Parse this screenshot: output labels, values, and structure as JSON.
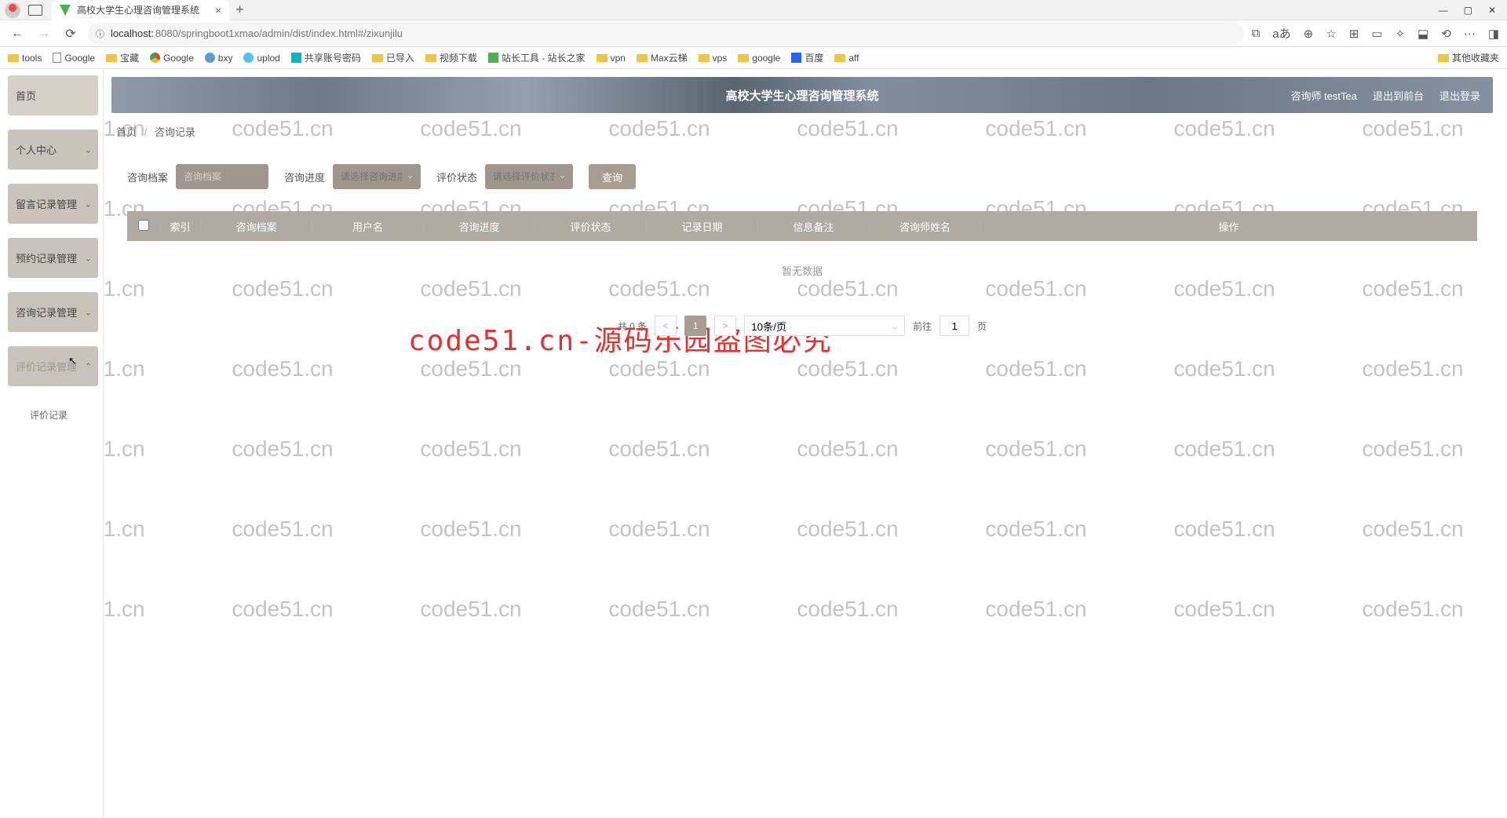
{
  "browser": {
    "tab_title": "高校大学生心理咨询管理系统",
    "url_host": "localhost:",
    "url_path": "8080/springboot1xmao/admin/dist/index.html#/zixunjilu",
    "addr_info_icon": "ⓘ"
  },
  "bookmarks": {
    "items": [
      "tools",
      "Google",
      "宝藏",
      "Google",
      "bxy",
      "uplod",
      "共享账号密码",
      "已导入",
      "视频下载",
      "站长工具 - 站长之家",
      "vpn",
      "Max云梯",
      "vps",
      "google",
      "百度",
      "aff"
    ],
    "other": "其他收藏夹"
  },
  "sidebar": {
    "home": "首页",
    "items": [
      "个人中心",
      "留言记录管理",
      "预约记录管理",
      "咨询记录管理",
      "评价记录管理"
    ],
    "sub_item": "评价记录"
  },
  "header": {
    "title": "高校大学生心理咨询管理系统",
    "user_role": "咨询师 testTea",
    "exit_front": "退出到前台",
    "logout": "退出登录"
  },
  "breadcrumb": {
    "home": "首页",
    "current": "咨询记录"
  },
  "filters": {
    "archive_label": "咨询档案",
    "archive_placeholder": "咨询档案",
    "progress_label": "咨询进度",
    "progress_placeholder": "请选择咨询进度",
    "status_label": "评价状态",
    "status_placeholder": "请选择评价状态",
    "query_btn": "查询"
  },
  "table": {
    "cols": {
      "index": "索引",
      "archive": "咨询档案",
      "username": "用户名",
      "progress": "咨询进度",
      "status": "评价状态",
      "date": "记录日期",
      "remark": "信息备注",
      "consultant": "咨询师姓名",
      "ops": "操作"
    },
    "empty": "暂无数据"
  },
  "pager": {
    "total": "共 0 条",
    "current": "1",
    "size": "10条/页",
    "goto_prefix": "前往",
    "goto_value": "1",
    "goto_suffix": "页"
  },
  "watermark": {
    "text": "code51.cn",
    "big": "code51.cn-源码乐园盗图必究"
  }
}
